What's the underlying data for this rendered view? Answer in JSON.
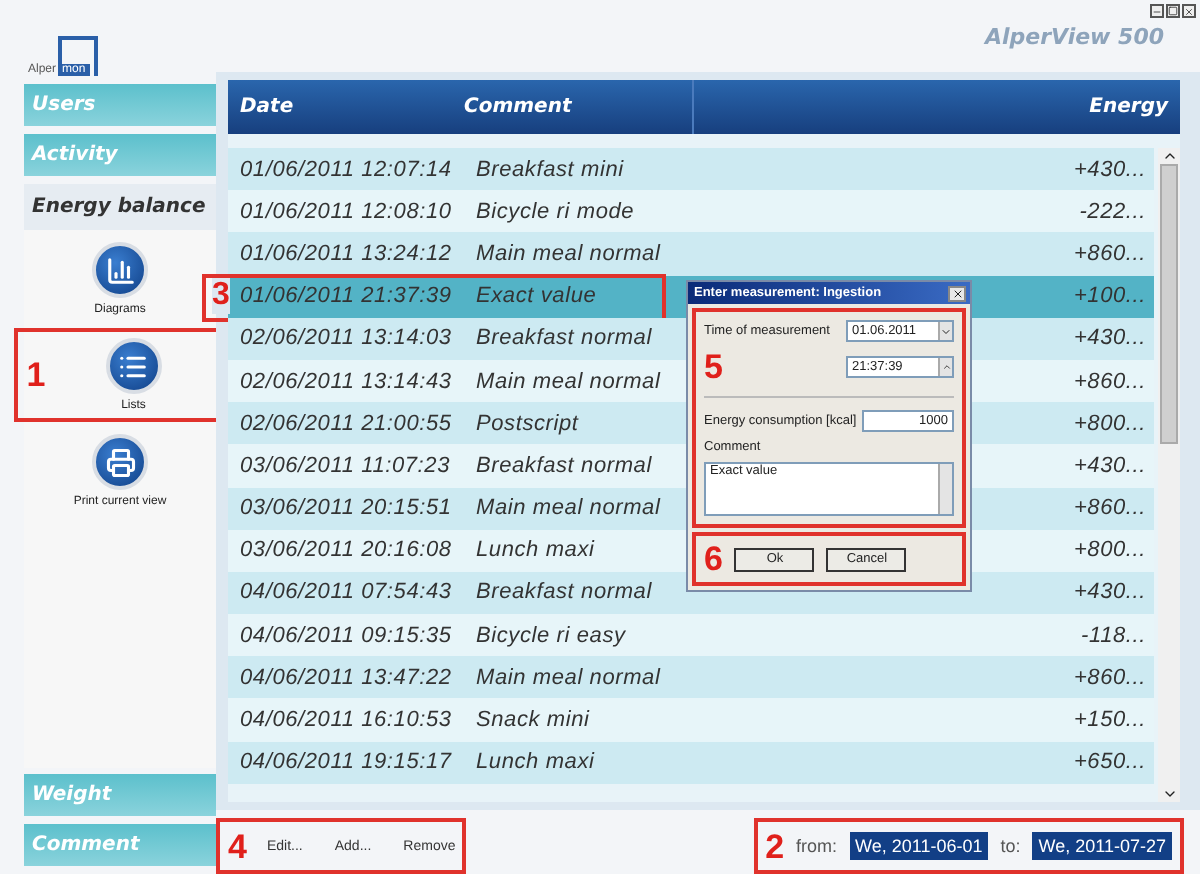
{
  "window": {
    "title": "AlperView 500"
  },
  "logo": {
    "text": "Alper",
    "highlight": "mon"
  },
  "sidebar": {
    "tabs": [
      {
        "label": "Users",
        "selected": false
      },
      {
        "label": "Activity",
        "selected": false
      },
      {
        "label": "Energy balance",
        "selected": true
      }
    ],
    "views": [
      {
        "label": "Diagrams",
        "kind": "chart"
      },
      {
        "label": "Lists",
        "kind": "list",
        "callout": "1"
      },
      {
        "label": "Print current view",
        "kind": "printer"
      }
    ],
    "bottom_tabs": [
      {
        "label": "Weight",
        "selected": false
      },
      {
        "label": "Comment",
        "selected": false
      }
    ]
  },
  "table": {
    "columns": [
      "Date",
      "Comment",
      "Energy"
    ],
    "rows": [
      {
        "date": "01/06/2011 12:07:14",
        "comment": "Breakfast mini",
        "energy": "+430...",
        "selected": false
      },
      {
        "date": "01/06/2011 12:08:10",
        "comment": "Bicycle ri  mode",
        "energy": "-222...",
        "selected": false
      },
      {
        "date": "01/06/2011 13:24:12",
        "comment": "Main meal normal",
        "energy": "+860...",
        "selected": false
      },
      {
        "date": "01/06/2011 21:37:39",
        "comment": "Exact value",
        "energy": "+100...",
        "selected": true,
        "callout": "3"
      },
      {
        "date": "02/06/2011 13:14:03",
        "comment": "Breakfast normal",
        "energy": "+430...",
        "selected": false
      },
      {
        "date": "02/06/2011 13:14:43",
        "comment": "Main meal normal",
        "energy": "+860...",
        "selected": false
      },
      {
        "date": "02/06/2011 21:00:55",
        "comment": "Postscript",
        "energy": "+800...",
        "selected": false
      },
      {
        "date": "03/06/2011 11:07:23",
        "comment": "Breakfast normal",
        "energy": "+430...",
        "selected": false
      },
      {
        "date": "03/06/2011 20:15:51",
        "comment": "Main meal normal",
        "energy": "+860...",
        "selected": false
      },
      {
        "date": "03/06/2011 20:16:08",
        "comment": "Lunch maxi",
        "energy": "+800...",
        "selected": false
      },
      {
        "date": "04/06/2011 07:54:43",
        "comment": "Breakfast normal",
        "energy": "+430...",
        "selected": false
      },
      {
        "date": "04/06/2011 09:15:35",
        "comment": "Bicycle ri easy",
        "energy": "-118...",
        "selected": false
      },
      {
        "date": "04/06/2011 13:47:22",
        "comment": "Main meal normal",
        "energy": "+860...",
        "selected": false
      },
      {
        "date": "04/06/2011 16:10:53",
        "comment": "Snack mini",
        "energy": "+150...",
        "selected": false
      },
      {
        "date": "04/06/2011 19:15:17",
        "comment": "Lunch maxi",
        "energy": "+650...",
        "selected": false
      }
    ]
  },
  "toolbar": {
    "callout": "4",
    "buttons": [
      "Edit...",
      "Add...",
      "Remove"
    ]
  },
  "date_range": {
    "callout": "2",
    "from_label": "from:",
    "from": "We, 2011-06-01",
    "to_label": "to:",
    "to": "We, 2011-07-27"
  },
  "dialog": {
    "title": "Enter measurement: Ingestion",
    "fields_callout": "5",
    "time_label": "Time of measurement",
    "date": "01.06.2011",
    "time": "21:37:39",
    "energy_label": "Energy consumption [kcal]",
    "energy": "1000",
    "comment_label": "Comment",
    "comment": "Exact value",
    "buttons_callout": "6",
    "buttons": [
      "Ok",
      "Cancel"
    ]
  }
}
